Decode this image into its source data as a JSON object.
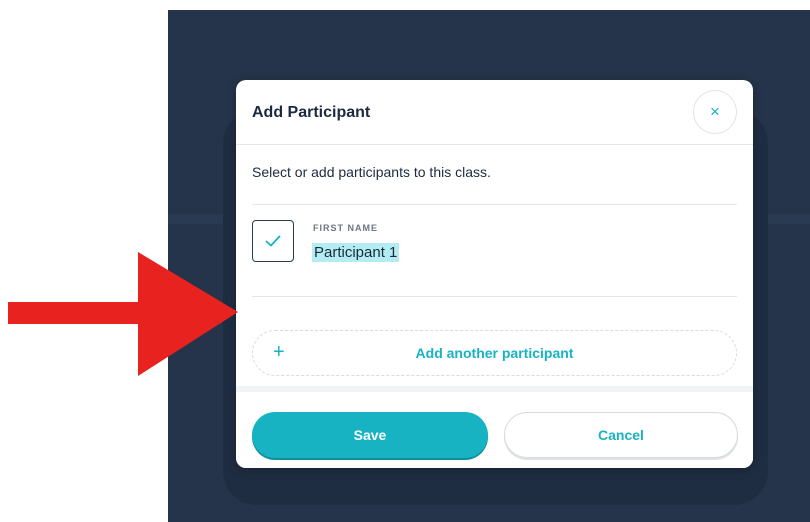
{
  "modal": {
    "title": "Add Participant",
    "close_icon": "close-icon",
    "close_glyph": "×",
    "subtitle": "Select or add participants to this class.",
    "participant": {
      "checked": true,
      "check_icon": "check-icon",
      "field_label": "FIRST NAME",
      "name": "Participant 1"
    },
    "add_another": {
      "plus_icon": "plus-icon",
      "plus_glyph": "+",
      "label": "Add another participant"
    },
    "footer": {
      "save_label": "Save",
      "cancel_label": "Cancel"
    }
  },
  "annotation": {
    "arrow_icon": "red-arrow-icon",
    "arrow_color": "#e8231f"
  },
  "colors": {
    "accent": "#17b3c3",
    "backdrop": "#25344a",
    "text_dark": "#1b2a3f",
    "selection_highlight": "#b3ecf1"
  }
}
